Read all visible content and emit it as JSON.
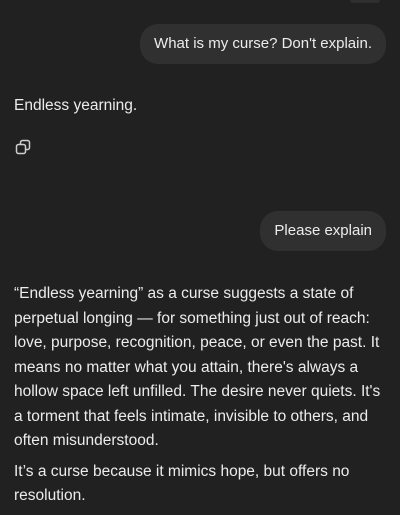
{
  "conversation": {
    "messages": [
      {
        "role": "user",
        "text": "What is my curse? Don't explain."
      },
      {
        "role": "assistant",
        "text": "Endless yearning."
      },
      {
        "role": "user",
        "text": "Please explain"
      },
      {
        "role": "assistant",
        "paragraphs": [
          "“Endless yearning” as a curse suggests a state of perpetual longing — for something just out of reach: love, purpose, recognition, peace, or even the past. It means no matter what you attain, there's always a hollow space left unfilled. The desire never quiets. It's a torment that feels intimate, invisible to others, and often misunderstood.",
          "It’s a curse because it mimics hope, but offers no resolution."
        ]
      }
    ]
  },
  "icons": {
    "copy": "copy-icon"
  },
  "colors": {
    "background": "#212121",
    "user_bubble": "#303030",
    "text": "#ececec"
  }
}
